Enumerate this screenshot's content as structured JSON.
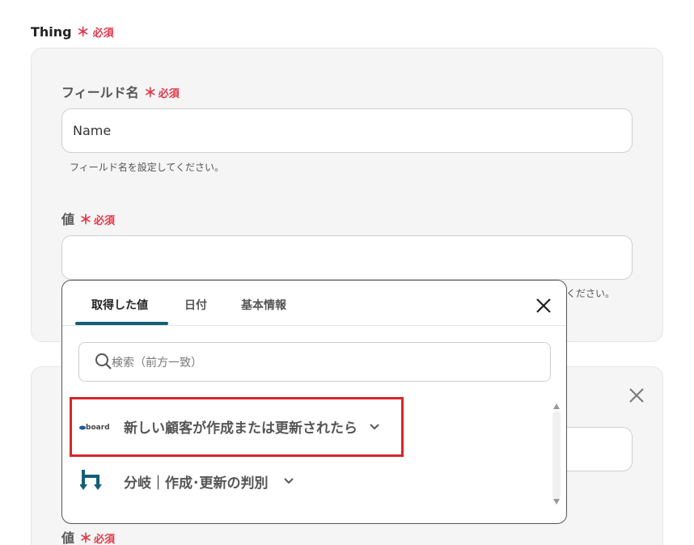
{
  "thing": {
    "label": "Thing",
    "required_mark": "＊",
    "required_text": "必須"
  },
  "field_name": {
    "label": "フィールド名",
    "required_mark": "＊",
    "required_text": "必須",
    "value": "Name",
    "hint": "フィールド名を設定してください。"
  },
  "value_field": {
    "label": "値",
    "required_mark": "＊",
    "required_text": "必須",
    "value": "",
    "hint_tail": "ください。"
  },
  "bottom_value": {
    "label": "値",
    "required_mark": "＊",
    "required_text": "必須"
  },
  "popup": {
    "tabs": [
      {
        "label": "取得した値",
        "active": true
      },
      {
        "label": "日付",
        "active": false
      },
      {
        "label": "基本情報",
        "active": false
      }
    ],
    "search": {
      "placeholder": "検索（前方一致）"
    },
    "items": [
      {
        "icon": "board-logo",
        "logo_text": "board",
        "label": "新しい顧客が作成または更新されたら",
        "highlighted": true
      },
      {
        "icon": "branch-icon",
        "label": "分岐｜作成･更新の判別",
        "highlighted": false
      }
    ]
  },
  "colors": {
    "accent": "#155e75",
    "required": "#e0384a",
    "highlight": "#d6262b"
  }
}
